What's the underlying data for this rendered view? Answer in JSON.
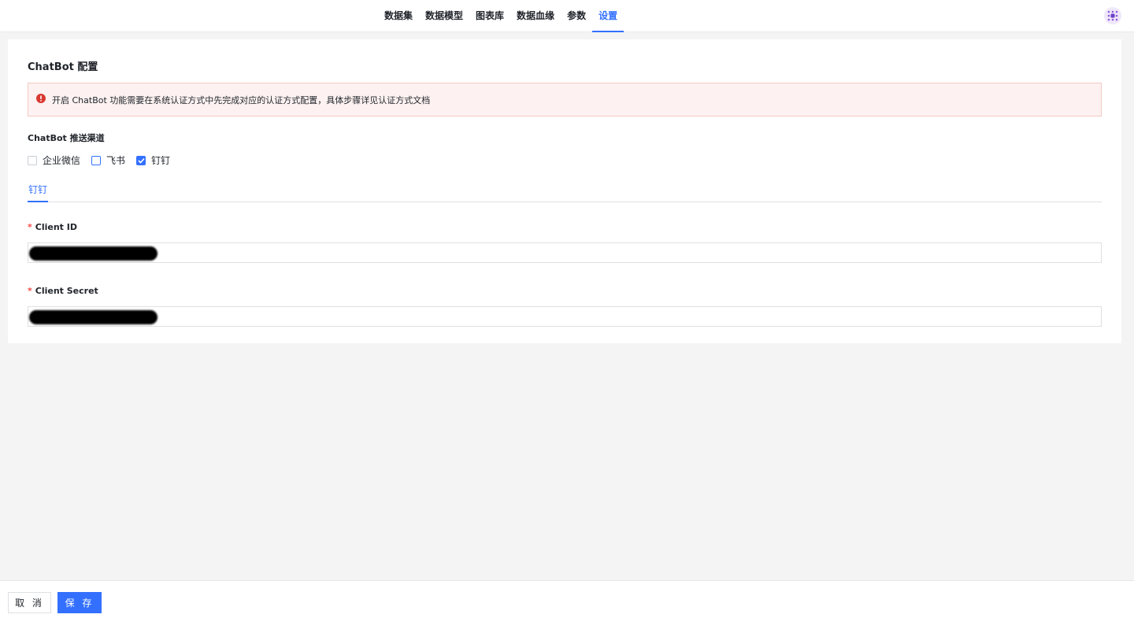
{
  "nav": {
    "items": [
      {
        "label": "数据集"
      },
      {
        "label": "数据模型"
      },
      {
        "label": "图表库"
      },
      {
        "label": "数据血缘"
      },
      {
        "label": "参数"
      },
      {
        "label": "设置"
      }
    ],
    "active": "设置",
    "logo_icon": "grid-dots-logo-icon"
  },
  "card": {
    "title": "ChatBot 配置",
    "alert": {
      "icon": "error-circle-icon",
      "text": "开启 ChatBot 功能需要在系统认证方式中先完成对应的认证方式配置，具体步骤详见认证方式文档"
    },
    "channels": {
      "label": "ChatBot 推送渠道",
      "options": [
        {
          "label": "企业微信",
          "checked": false
        },
        {
          "label": "飞书",
          "checked": false
        },
        {
          "label": "钉钉",
          "checked": true
        }
      ]
    },
    "tabs": [
      {
        "label": "钉钉"
      }
    ],
    "fields": {
      "client_id": {
        "required_mark": "*",
        "label": "Client ID"
      },
      "client_secret": {
        "required_mark": "*",
        "label": "Client Secret"
      }
    }
  },
  "footer": {
    "cancel_label": "取 消",
    "save_label": "保 存"
  },
  "colors": {
    "accent": "#3370ff",
    "error": "#d83931",
    "alert_bg": "#fdf2f1"
  }
}
